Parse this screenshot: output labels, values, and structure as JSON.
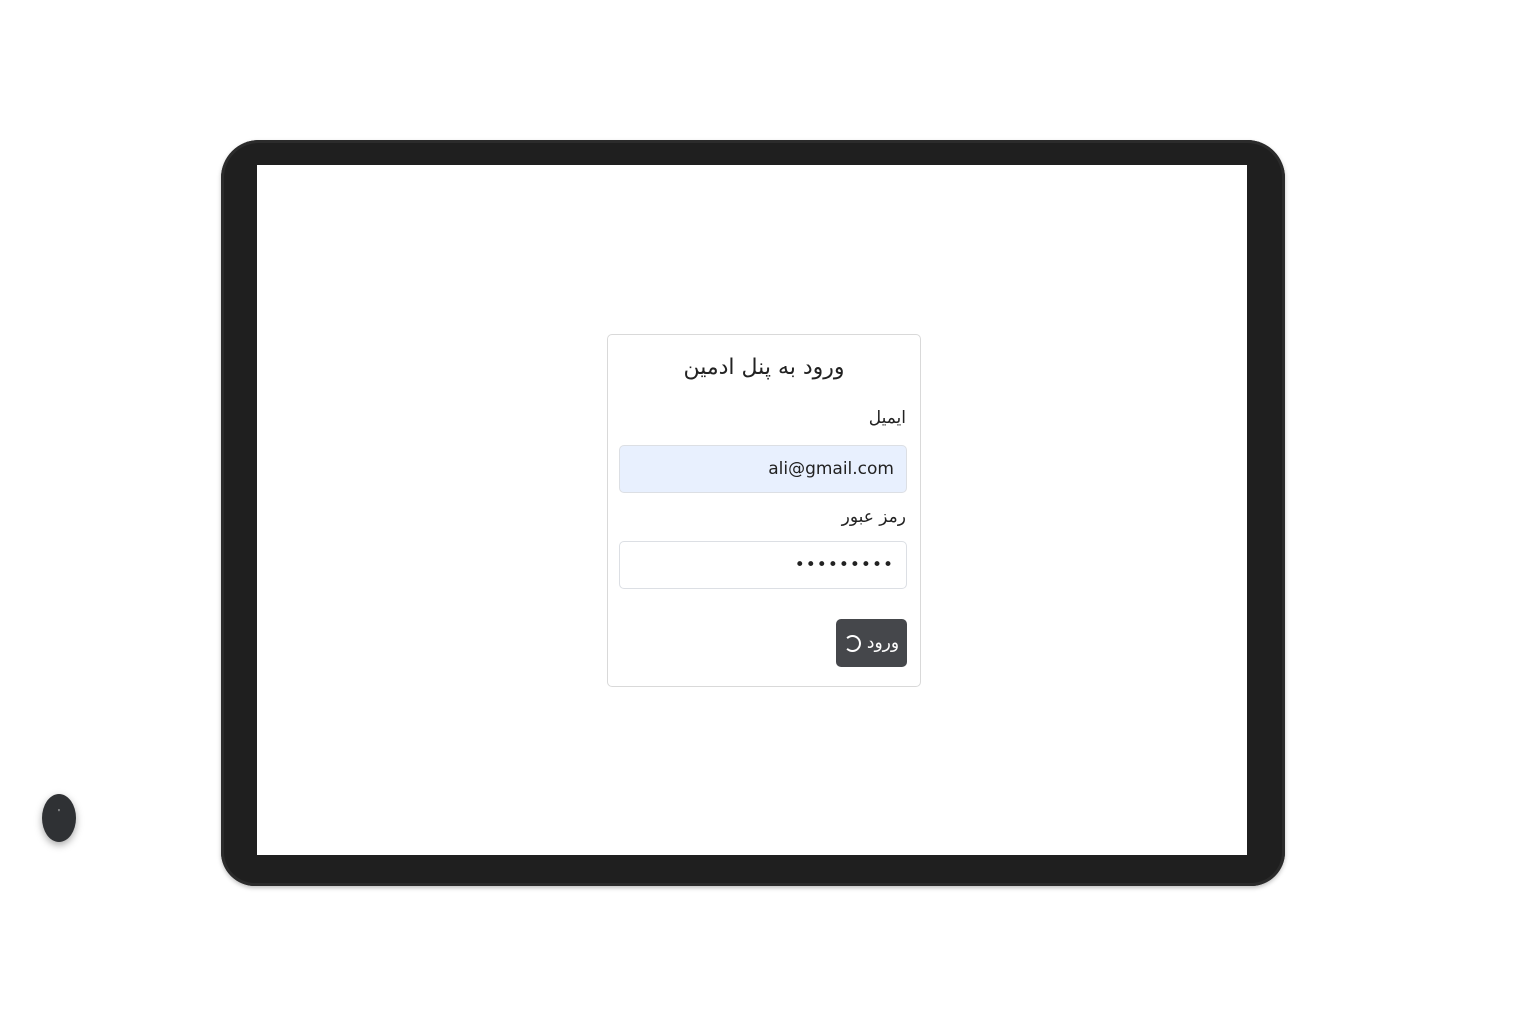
{
  "login": {
    "title": "ورود به پنل ادمین",
    "email_label": "ایمیل",
    "email_value": "ali@gmail.com",
    "password_label": "رمز عبور",
    "password_value": "•••••••••",
    "submit_label": "ورود"
  },
  "fab": {
    "icon": "'"
  },
  "colors": {
    "device_frame": "#1f1f1f",
    "email_autofill_bg": "#e8f0fe",
    "button_bg": "#45474b",
    "fab_bg": "#2f3134"
  }
}
